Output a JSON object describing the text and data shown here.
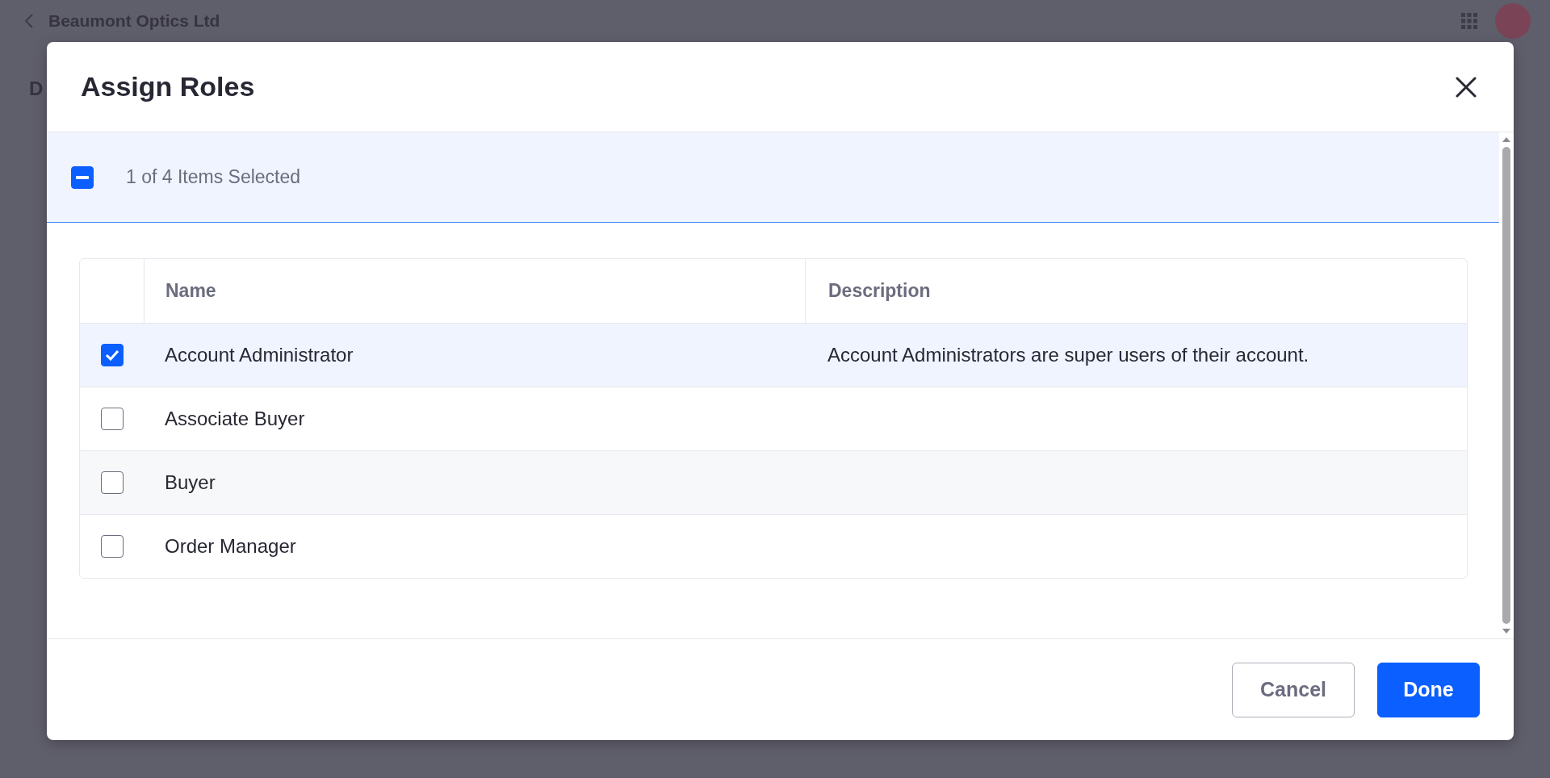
{
  "page": {
    "title": "Beaumont Optics Ltd",
    "heading": "D"
  },
  "modal": {
    "title": "Assign Roles",
    "selection_bar": {
      "label": "1 of 4 Items Selected",
      "indeterminate": true
    },
    "table": {
      "columns": [
        "Name",
        "Description"
      ],
      "rows": [
        {
          "name": "Account Administrator",
          "description": "Account Administrators are super users of their account.",
          "selected": true
        },
        {
          "name": "Associate Buyer",
          "description": "",
          "selected": false
        },
        {
          "name": "Buyer",
          "description": "",
          "selected": false
        },
        {
          "name": "Order Manager",
          "description": "",
          "selected": false
        }
      ]
    },
    "buttons": [
      {
        "label": "Cancel",
        "kind": "secondary"
      },
      {
        "label": "Done",
        "kind": "primary"
      }
    ]
  }
}
